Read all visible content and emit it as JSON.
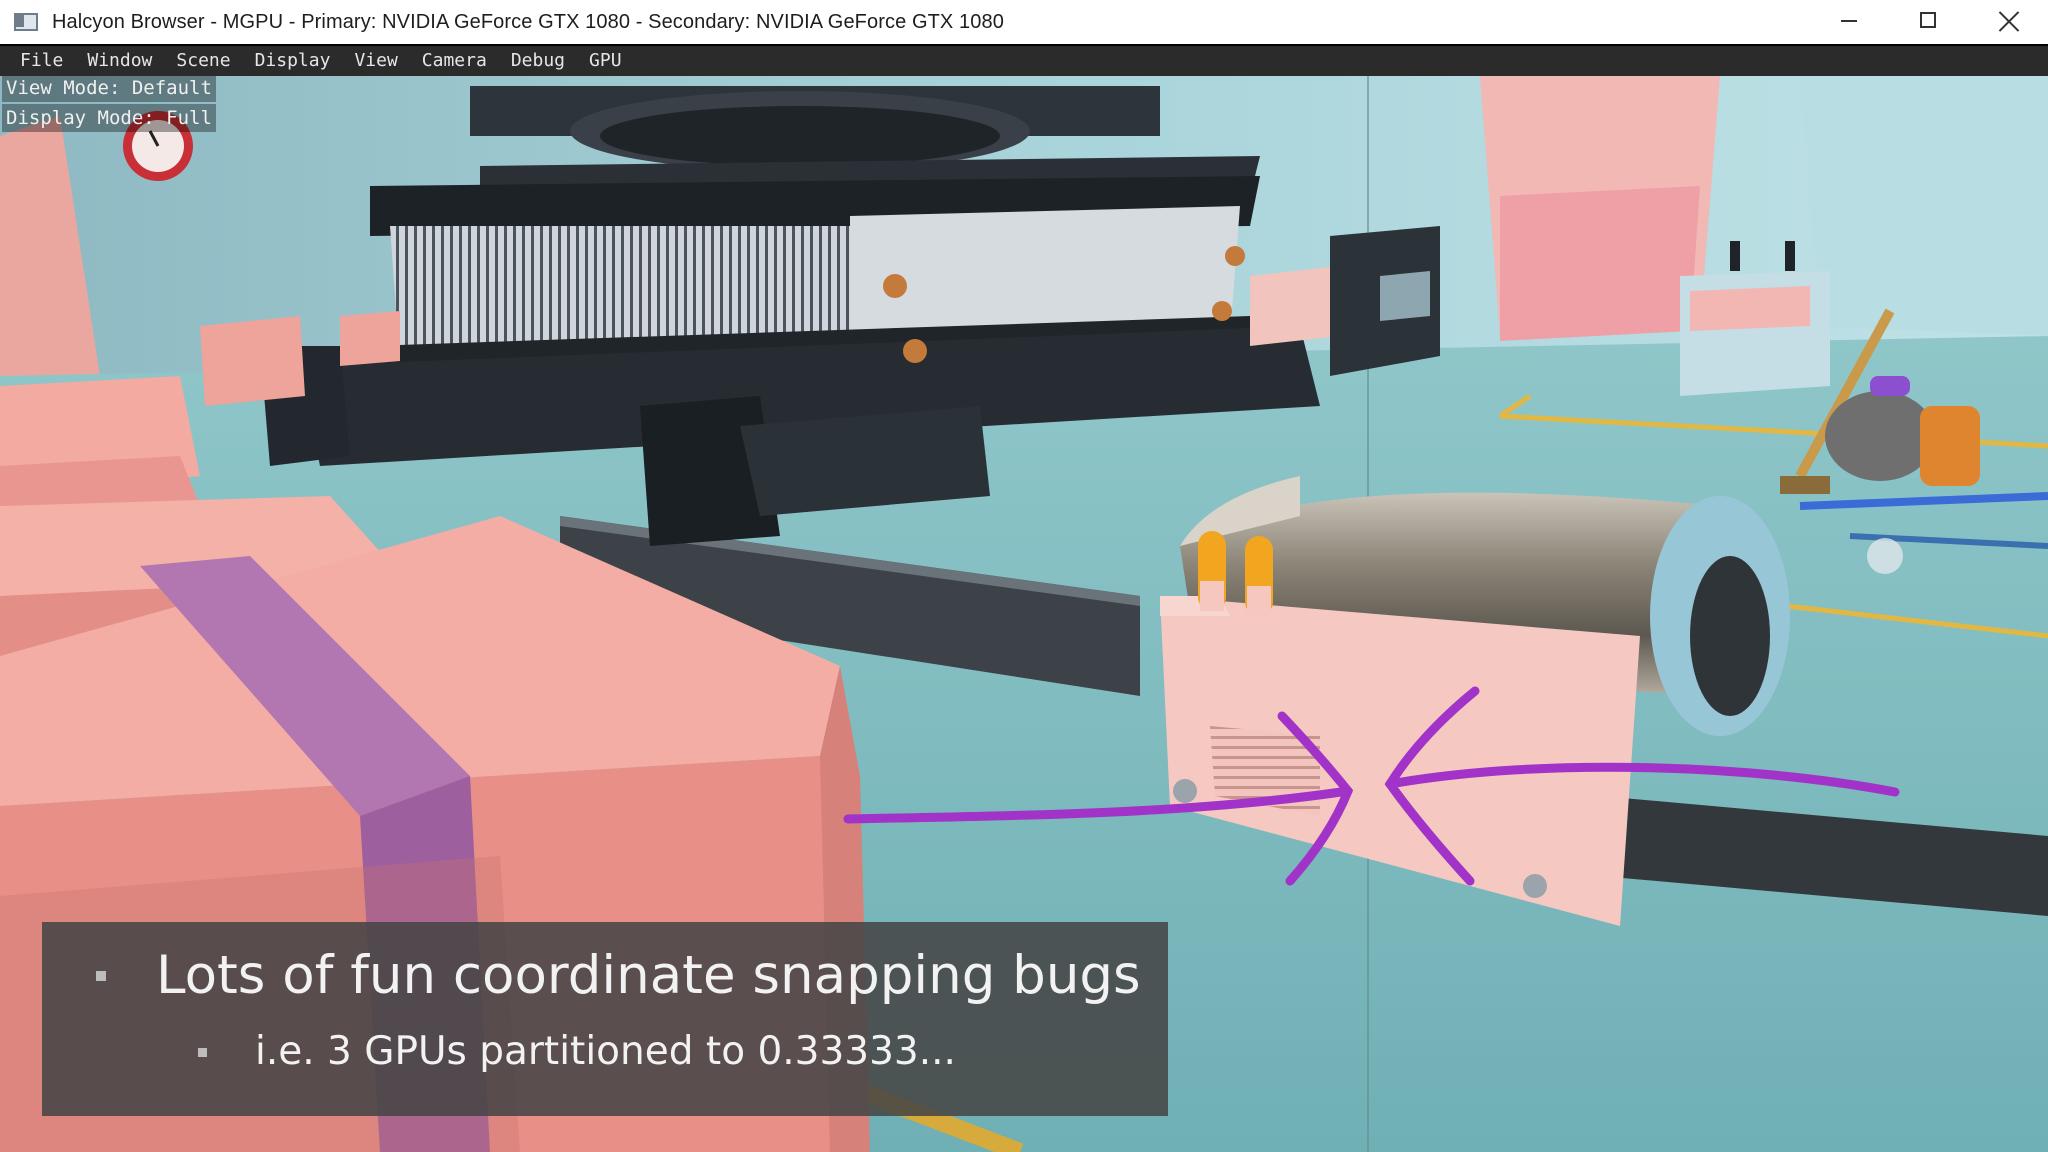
{
  "window": {
    "title": "Halcyon Browser - MGPU - Primary: NVIDIA GeForce GTX 1080 - Secondary: NVIDIA GeForce GTX 1080",
    "app_icon": "window-app-icon",
    "controls": [
      "minimize-icon",
      "maximize-icon",
      "close-icon"
    ]
  },
  "menu": {
    "items": [
      "File",
      "Window",
      "Scene",
      "Display",
      "View",
      "Camera",
      "Debug",
      "GPU"
    ]
  },
  "viewport": {
    "view_mode": "View Mode: Default",
    "display_mode": "Display Mode: Full"
  },
  "caption": {
    "bullet1": "Lots of fun coordinate snapping bugs",
    "bullet2": "i.e. 3 GPUs partitioned to 0.33333..."
  },
  "colors": {
    "annotation": "#a233c8",
    "floor": "#7fbcc0",
    "box_pink": "#f0a39b"
  }
}
